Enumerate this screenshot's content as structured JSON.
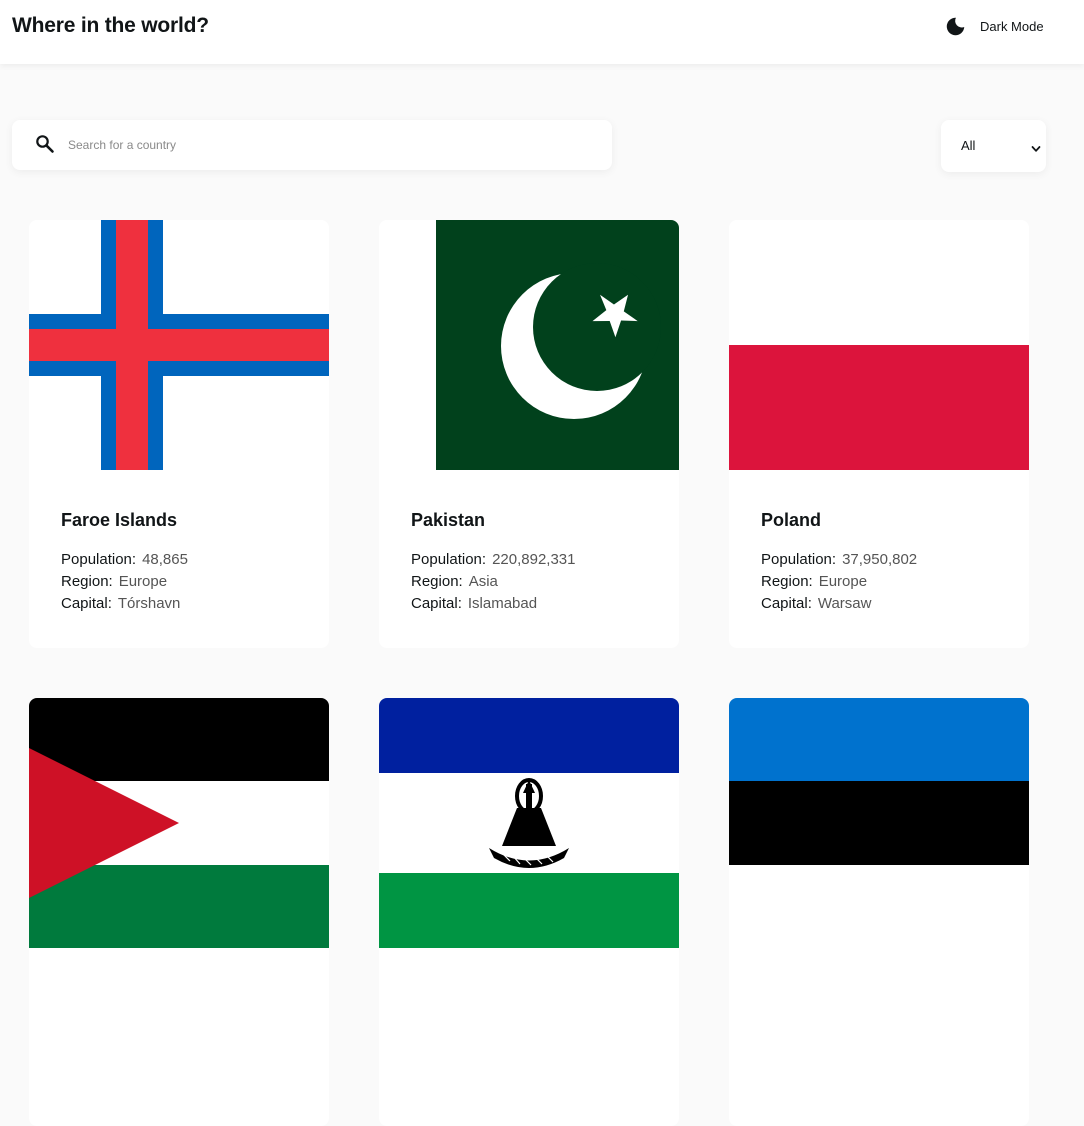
{
  "header": {
    "title": "Where in the world?",
    "dark_mode_label": "Dark Mode",
    "dark_mode_icon": "moon-icon"
  },
  "search": {
    "placeholder": "Search for a country",
    "value": "",
    "icon": "search-icon"
  },
  "filter": {
    "selected": "All",
    "icon": "chevron-down-icon"
  },
  "labels": {
    "population": "Population:",
    "region": "Region:",
    "capital": "Capital:"
  },
  "countries": [
    {
      "name": "Faroe Islands",
      "population": "48,865",
      "region": "Europe",
      "capital": "Tórshavn",
      "flag": "faroe-islands-flag"
    },
    {
      "name": "Pakistan",
      "population": "220,892,331",
      "region": "Asia",
      "capital": "Islamabad",
      "flag": "pakistan-flag"
    },
    {
      "name": "Poland",
      "population": "37,950,802",
      "region": "Europe",
      "capital": "Warsaw",
      "flag": "poland-flag"
    },
    {
      "name": "",
      "population": "",
      "region": "",
      "capital": "",
      "flag": "palestine-flag"
    },
    {
      "name": "",
      "population": "",
      "region": "",
      "capital": "",
      "flag": "lesotho-flag"
    },
    {
      "name": "",
      "population": "",
      "region": "",
      "capital": "",
      "flag": "estonia-flag"
    }
  ],
  "colors": {
    "background": "#fafafa",
    "surface": "#ffffff",
    "text": "#111517"
  }
}
